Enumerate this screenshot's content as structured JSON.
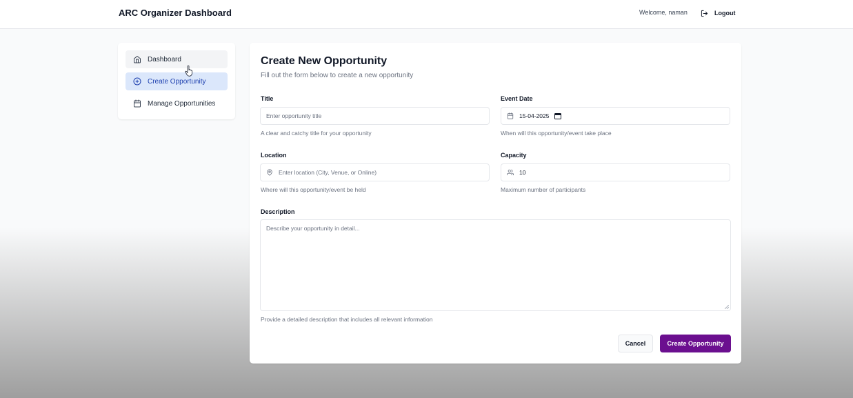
{
  "header": {
    "app_title": "ARC Organizer Dashboard",
    "welcome_text": "Welcome, naman",
    "logout_label": "Logout"
  },
  "sidebar": {
    "items": [
      {
        "label": "Dashboard",
        "icon": "home-icon",
        "state": "hover"
      },
      {
        "label": "Create Opportunity",
        "icon": "plus-circle-icon",
        "state": "active"
      },
      {
        "label": "Manage Opportunities",
        "icon": "calendar-icon",
        "state": "default"
      }
    ]
  },
  "form": {
    "title": "Create New Opportunity",
    "subtitle": "Fill out the form below to create a new opportunity",
    "fields": {
      "title": {
        "label": "Title",
        "placeholder": "Enter opportunity title",
        "value": "",
        "help": "A clear and catchy title for your opportunity"
      },
      "event_date": {
        "label": "Event Date",
        "value": "15-04-2025",
        "help": "When will this opportunity/event take place",
        "icon": "calendar-icon"
      },
      "location": {
        "label": "Location",
        "placeholder": "Enter location (City, Venue, or Online)",
        "value": "",
        "help": "Where will this opportunity/event be held",
        "icon": "map-pin-icon"
      },
      "capacity": {
        "label": "Capacity",
        "value": "10",
        "help": "Maximum number of participants",
        "icon": "users-icon"
      },
      "description": {
        "label": "Description",
        "placeholder": "Describe your opportunity in detail...",
        "value": "",
        "help": "Provide a detailed description that includes all relevant information"
      }
    },
    "buttons": {
      "cancel": "Cancel",
      "submit": "Create Opportunity"
    }
  },
  "colors": {
    "primary": "#6b0f8f",
    "active_nav_bg": "#dbe7fb",
    "active_nav_text": "#1e40af"
  }
}
